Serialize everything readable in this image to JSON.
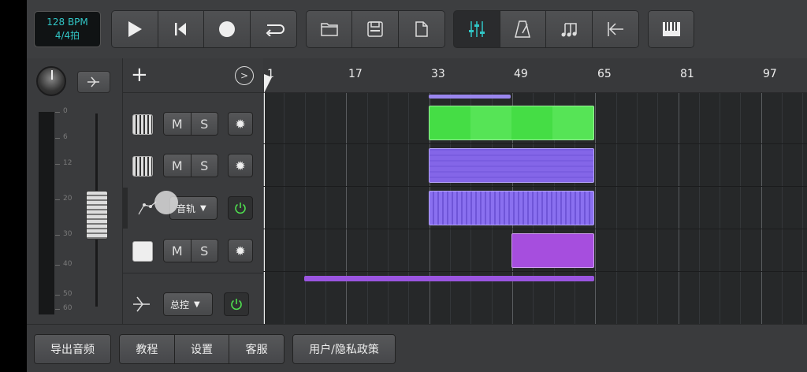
{
  "app": {
    "tempo": {
      "bpm": "128 BPM",
      "meter": "4/4拍"
    },
    "transport": [
      "play-icon",
      "skip-back-icon",
      "record-icon",
      "loop-icon"
    ],
    "file": [
      "folder-icon",
      "save-icon",
      "new-file-icon"
    ],
    "view": [
      "mixer-icon",
      "metronome-icon",
      "notes-icon",
      "return-to-start-icon"
    ],
    "keyboard": "piano-icon"
  },
  "ruler": {
    "marks": [
      "1",
      "17",
      "33",
      "49",
      "65",
      "81",
      "97"
    ]
  },
  "mixer": {
    "scale": [
      "0",
      "6",
      "12",
      "20",
      "30",
      "40",
      "50",
      "60"
    ]
  },
  "tracks": [
    {
      "type": "midi",
      "mute": "M",
      "solo": "S"
    },
    {
      "type": "midi",
      "mute": "M",
      "solo": "S"
    },
    {
      "type": "automation",
      "dropdown": "音轨"
    },
    {
      "type": "drum",
      "mute": "M",
      "solo": "S"
    },
    {
      "type": "master",
      "dropdown": "总控"
    }
  ],
  "bottom": {
    "export": "导出音频",
    "tutorial": "教程",
    "settings": "设置",
    "support": "客服",
    "policy": "用户/隐私政策"
  },
  "colors": {
    "accent": "#31c6c6",
    "green": "#4fe04f",
    "purple": "#8a6ff0",
    "magenta": "#a855e0"
  }
}
